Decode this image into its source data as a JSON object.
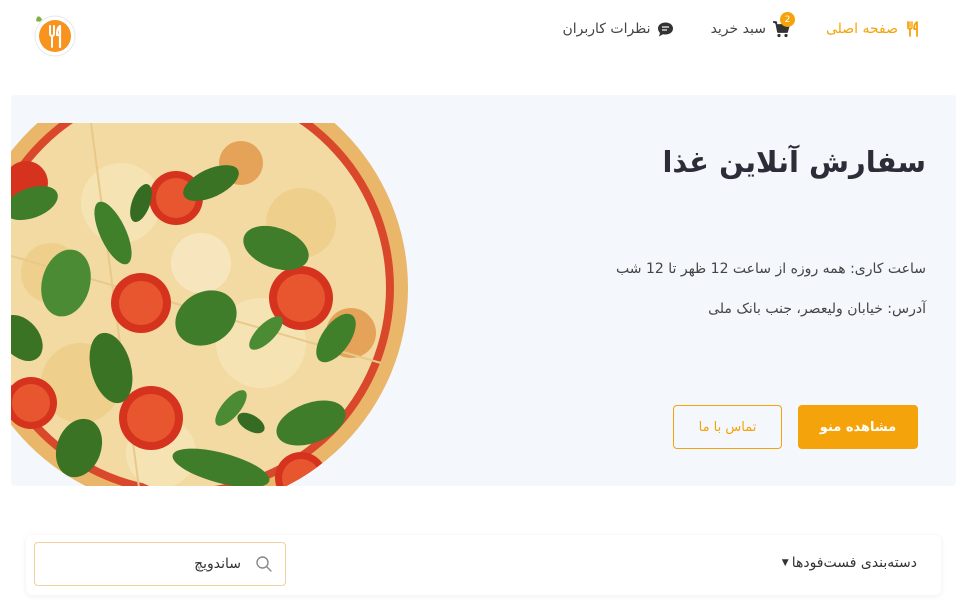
{
  "nav": {
    "home_label": "صفحه اصلی",
    "cart_label": "سبد خرید",
    "cart_count": "2",
    "reviews_label": "نظرات کاربران"
  },
  "hero": {
    "title": "سفارش آنلاین غذا",
    "hours": "ساعت کاری: همه روزه از ساعت 12 ظهر تا 12 شب",
    "address": "آدرس: خیابان ولیعصر، جنب بانک ملی",
    "menu_button": "مشاهده منو",
    "contact_button": "تماس با ما"
  },
  "filter": {
    "category_label": "دسته‌بندی فست‌فودها",
    "search_value": "ساندویچ"
  },
  "colors": {
    "accent": "#f5a30a",
    "hero_bg": "#f4f7fb",
    "title": "#2d2d3a"
  },
  "icons": {
    "home": "fork-knife-icon",
    "cart": "cart-icon",
    "reviews": "chat-bubble-icon",
    "search": "search-icon",
    "logo": "logo-fork-knife-icon"
  }
}
